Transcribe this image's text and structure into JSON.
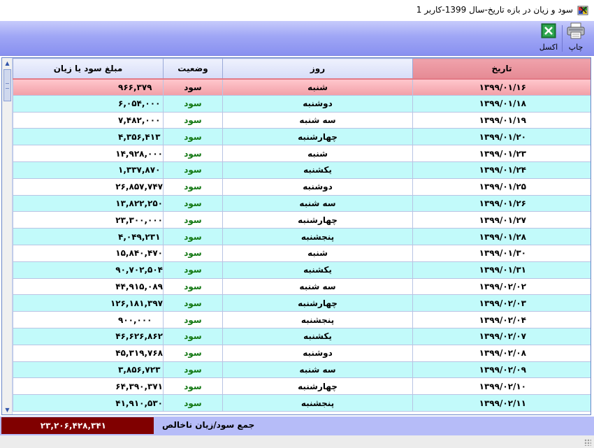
{
  "window": {
    "title": "سود و زیان در بازه تاریخ-سال 1399-کاربر 1",
    "close_glyph": "✕"
  },
  "toolbar": {
    "print_label": "چاپ",
    "excel_label": "اکسل"
  },
  "grid": {
    "columns": [
      "تاریخ",
      "روز",
      "وضعیت",
      "مبلغ سود یا زیان"
    ],
    "sorted_column": "تاریخ",
    "rows": [
      {
        "date": "۱۳۹۹/۰۱/۱۶",
        "day": "شنبه",
        "status": "سود",
        "amount": "۹۶۶,۳۷۹"
      },
      {
        "date": "۱۳۹۹/۰۱/۱۸",
        "day": "دوشنبه",
        "status": "سود",
        "amount": "۶,۰۵۴,۰۰۰"
      },
      {
        "date": "۱۳۹۹/۰۱/۱۹",
        "day": "سه شنبه",
        "status": "سود",
        "amount": "۷,۴۸۲,۰۰۰"
      },
      {
        "date": "۱۳۹۹/۰۱/۲۰",
        "day": "چهارشنبه",
        "status": "سود",
        "amount": "۴,۳۵۶,۴۱۳"
      },
      {
        "date": "۱۳۹۹/۰۱/۲۳",
        "day": "شنبه",
        "status": "سود",
        "amount": "۱۴,۹۲۸,۰۰۰"
      },
      {
        "date": "۱۳۹۹/۰۱/۲۴",
        "day": "یکشنبه",
        "status": "سود",
        "amount": "۱,۳۳۷,۸۷۰"
      },
      {
        "date": "۱۳۹۹/۰۱/۲۵",
        "day": "دوشنبه",
        "status": "سود",
        "amount": "۲۶,۸۵۷,۷۴۷"
      },
      {
        "date": "۱۳۹۹/۰۱/۲۶",
        "day": "سه شنبه",
        "status": "سود",
        "amount": "۱۳,۸۲۲,۲۵۰"
      },
      {
        "date": "۱۳۹۹/۰۱/۲۷",
        "day": "چهارشنبه",
        "status": "سود",
        "amount": "۲۳,۳۰۰,۰۰۰"
      },
      {
        "date": "۱۳۹۹/۰۱/۲۸",
        "day": "پنجشنبه",
        "status": "سود",
        "amount": "۴,۰۴۹,۲۳۱"
      },
      {
        "date": "۱۳۹۹/۰۱/۳۰",
        "day": "شنبه",
        "status": "سود",
        "amount": "۱۵,۸۴۰,۴۷۰"
      },
      {
        "date": "۱۳۹۹/۰۱/۳۱",
        "day": "یکشنبه",
        "status": "سود",
        "amount": "۹۰,۷۰۲,۵۰۴"
      },
      {
        "date": "۱۳۹۹/۰۲/۰۲",
        "day": "سه شنبه",
        "status": "سود",
        "amount": "۴۴,۹۱۵,۰۸۹"
      },
      {
        "date": "۱۳۹۹/۰۲/۰۳",
        "day": "چهارشنبه",
        "status": "سود",
        "amount": "۱۲۶,۱۸۱,۳۹۷"
      },
      {
        "date": "۱۳۹۹/۰۲/۰۴",
        "day": "پنجشنبه",
        "status": "سود",
        "amount": "۹۰۰,۰۰۰"
      },
      {
        "date": "۱۳۹۹/۰۲/۰۷",
        "day": "یکشنبه",
        "status": "سود",
        "amount": "۴۶,۶۲۶,۸۶۲"
      },
      {
        "date": "۱۳۹۹/۰۲/۰۸",
        "day": "دوشنبه",
        "status": "سود",
        "amount": "۴۵,۳۱۹,۷۶۸"
      },
      {
        "date": "۱۳۹۹/۰۲/۰۹",
        "day": "سه شنبه",
        "status": "سود",
        "amount": "۳,۸۵۶,۷۲۳"
      },
      {
        "date": "۱۳۹۹/۰۲/۱۰",
        "day": "چهارشنبه",
        "status": "سود",
        "amount": "۶۴,۳۹۰,۳۷۱"
      },
      {
        "date": "۱۳۹۹/۰۲/۱۱",
        "day": "پنجشنبه",
        "status": "سود",
        "amount": "۴۱,۹۱۰,۵۳۰"
      }
    ]
  },
  "footer": {
    "total_label": "جمع سود/زیان ناخالص",
    "total_value": "۲۳,۲۰۶,۴۲۸,۳۴۱"
  },
  "colors": {
    "toolbar": "#9fa6f5",
    "selected_row": "#f2a0a8",
    "alt_row": "#c2fafa",
    "status_profit": "#117711",
    "total_box": "#800000"
  }
}
